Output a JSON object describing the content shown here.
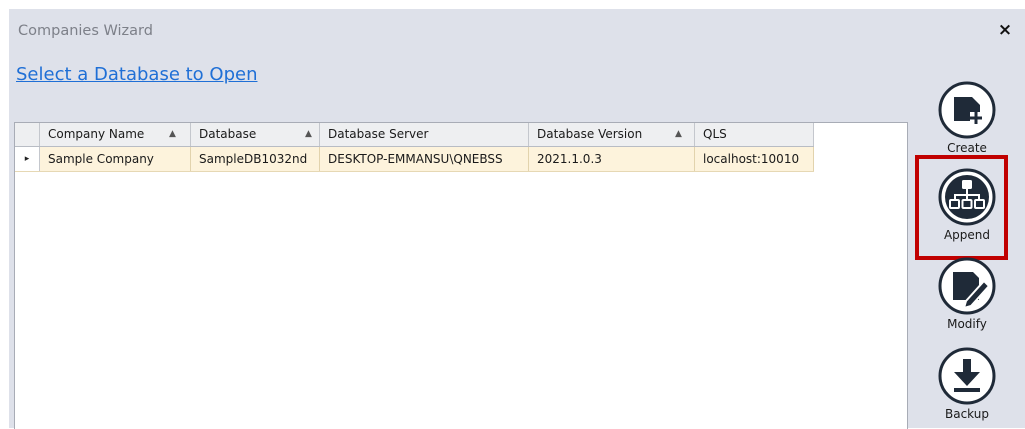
{
  "window": {
    "title": "Companies Wizard",
    "close_glyph": "×"
  },
  "main": {
    "link_text": "Select a Database to Open"
  },
  "grid": {
    "columns": [
      "Company Name",
      "Database",
      "Database Server",
      "Database Version",
      "QLS"
    ],
    "sorted_columns": [
      "Company Name",
      "Database",
      "Database Version"
    ],
    "rows": [
      {
        "indicator": "▸",
        "cells": [
          "Sample Company",
          "SampleDB1032nd",
          "DESKTOP-EMMANSU\\QNEBSS",
          "2021.1.0.3",
          "localhost:10010"
        ]
      }
    ],
    "sort_glyph": "▲"
  },
  "sidebar": {
    "buttons": [
      {
        "label": "Create",
        "icon": "database-plus-icon"
      },
      {
        "label": "Append",
        "icon": "org-chart-icon",
        "highlighted": true
      },
      {
        "label": "Modify",
        "icon": "database-edit-icon"
      },
      {
        "label": "Backup",
        "icon": "download-icon"
      }
    ]
  },
  "colors": {
    "window_bg": "#dee1ea",
    "link": "#1f6fd6",
    "selected_row": "#fdf3dc",
    "highlight_box": "#c00000",
    "icon": "#1f2a38"
  }
}
